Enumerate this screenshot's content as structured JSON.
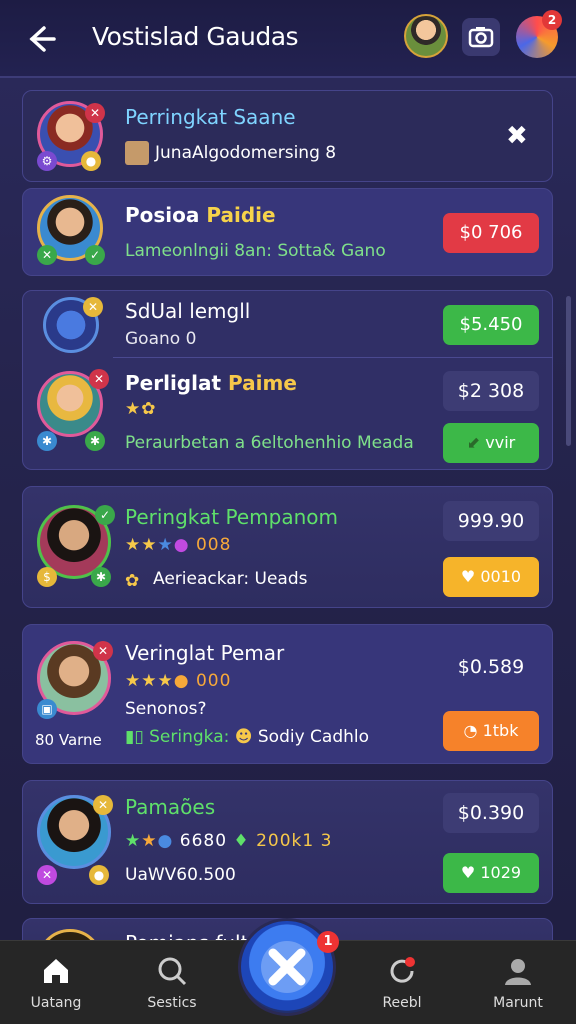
{
  "header": {
    "title": "Vostislad Gaudas",
    "notif_count": "2"
  },
  "cards": [
    {
      "title": "Perringkat Saane",
      "subtitle": "JunaAlgodomersing 8",
      "close_label": "✖",
      "title_color": "#7fd4ff"
    },
    {
      "title_a": "Posioa ",
      "title_b": "Paidie",
      "subtitle": "Lameonlngii 8an: Sotta& Gano",
      "price": "$0 706"
    },
    {
      "title": "SdUal lemgll",
      "subtitle": "Goano 0",
      "price": "$5.450"
    },
    {
      "title_a": "Perliglat ",
      "title_b": "Paime",
      "subtitle": "Peraurbetan a 6eltohenhio Meada",
      "price": "$2 308",
      "action": "vvir"
    },
    {
      "title": "Peringkat Pempanom",
      "rating_text": "008",
      "subtitle": "Aerieackar: Ueads",
      "price": "999.90",
      "action": "0010"
    },
    {
      "title": "Veringlat Pemar",
      "rating_text": "000",
      "line2": "Senonos?",
      "tag": "80 Varne",
      "subtitle_a": "Seringka:",
      "subtitle_b": "Sodiy Cadhlo",
      "price": "$0.589",
      "action": "1tbk"
    },
    {
      "title": "Pamaões",
      "rating_text": "6680",
      "rating_text2": "200k1 3",
      "subtitle": "UaWV60.500",
      "price": "$0.390",
      "action": "1029"
    },
    {
      "title": "Pomians fult"
    }
  ],
  "nav": [
    {
      "label": "Uatang",
      "icon": "home-icon"
    },
    {
      "label": "Sestics",
      "icon": "search-icon"
    },
    {
      "label": "Reebl",
      "icon": "refresh-icon"
    },
    {
      "label": "Marunt",
      "icon": "profile-icon"
    }
  ],
  "fab_badge": "1"
}
